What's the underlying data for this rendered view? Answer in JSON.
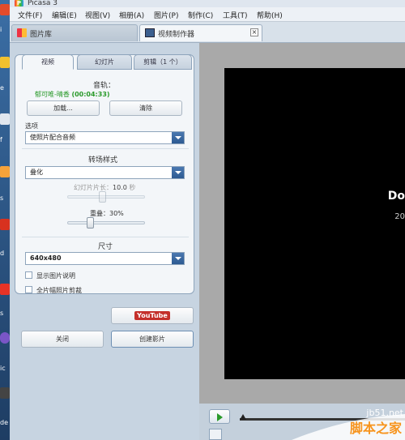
{
  "app": {
    "title": "Picasa 3",
    "logo_glyph": "P"
  },
  "desktop": {
    "labels": [
      "i",
      "e",
      "f",
      "s",
      "d",
      "s",
      "i",
      "a",
      "ic",
      "de"
    ]
  },
  "menu": [
    "文件(F)",
    "编辑(E)",
    "视图(V)",
    "相册(A)",
    "图片(P)",
    "制作(C)",
    "工具(T)",
    "帮助(H)"
  ],
  "tabs": [
    {
      "label": "图片库",
      "icon": "library-icon"
    },
    {
      "label": "视频制作器",
      "icon": "film-icon",
      "close": "×"
    }
  ],
  "panel": {
    "tabs": [
      "视频",
      "幻灯片",
      "剪辑（1 个）"
    ],
    "audio_title": "音轨：",
    "audio_track": "郁可唯-晴香",
    "audio_duration": "(00:04:33)",
    "load_button": "加载...",
    "clear_button": "清除",
    "options_label": "选项",
    "options_value": "使照片配合音频",
    "transition_title": "转场样式",
    "transition_value": "叠化",
    "slide_length_label": "幻灯片片长：",
    "slide_length_value": "10.0",
    "slide_length_unit": "秒",
    "overlap_label": "重叠：",
    "overlap_value": "30%",
    "size_title": "尺寸",
    "size_value": "640x480",
    "show_caption": "显示图片说明",
    "full_frame_crop": "全片幅照片剪裁"
  },
  "actions": {
    "youtube": "YouTube",
    "close": "关闭",
    "create_movie": "创建影片"
  },
  "preview": {
    "title": "Do",
    "subtitle": "20"
  },
  "watermark": {
    "domain": "jb51.net",
    "text": "脚本之家"
  },
  "colors": {
    "accent": "#2d5a92",
    "track_green": "#2a9a2a",
    "watermark_orange": "#f7941d"
  }
}
